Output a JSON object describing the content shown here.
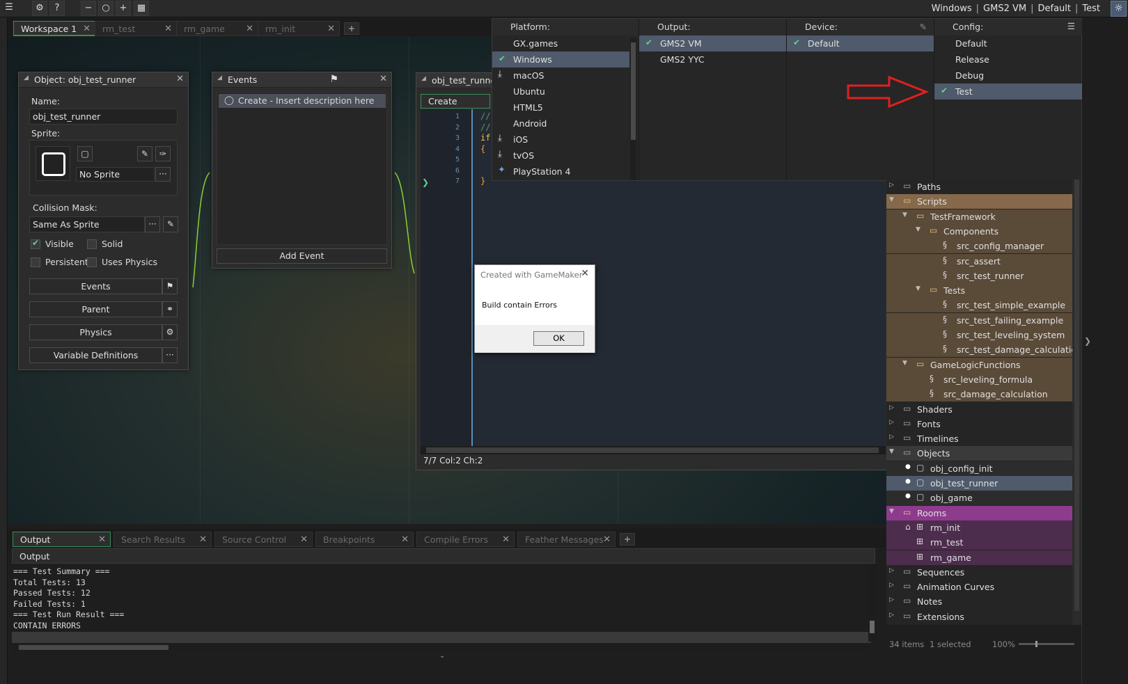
{
  "topbar": {
    "target": {
      "platform": "Windows",
      "output": "GMS2 VM",
      "config": "Default",
      "device": "Test",
      "sep": "|"
    },
    "icons": [
      "gear-icon",
      "help-icon",
      "zoom-out-icon",
      "zoom-reset-icon",
      "zoom-in-icon",
      "fit-icon",
      "target-icon"
    ]
  },
  "workspace_tabs": [
    {
      "label": "Workspace 1",
      "active": true
    },
    {
      "label": "rm_test",
      "active": false
    },
    {
      "label": "rm_game",
      "active": false
    },
    {
      "label": "rm_init",
      "active": false
    }
  ],
  "object_panel": {
    "title": "Object: obj_test_runner",
    "name_label": "Name:",
    "name_value": "obj_test_runner",
    "sprite_label": "Sprite:",
    "sprite_value": "No Sprite",
    "collision_label": "Collision Mask:",
    "collision_value": "Same As Sprite",
    "ellipsis": "···",
    "checkboxes": {
      "visible": {
        "label": "Visible",
        "checked": true
      },
      "solid": {
        "label": "Solid",
        "checked": false
      },
      "persistent": {
        "label": "Persistent",
        "checked": false
      },
      "uses_physics": {
        "label": "Uses Physics",
        "checked": false
      }
    },
    "buttons": {
      "events": "Events",
      "parent": "Parent",
      "physics": "Physics",
      "variable_definitions": "Variable Definitions"
    }
  },
  "events_panel": {
    "title": "Events",
    "item": "Create - Insert description here",
    "add_event": "Add Event"
  },
  "editor": {
    "title": "obj_test_runner:",
    "tab": "Create",
    "lines": [
      {
        "n": "1",
        "code": "//"
      },
      {
        "n": "2",
        "code": "//"
      },
      {
        "n": "3",
        "code": "if"
      },
      {
        "n": "4",
        "code": "{"
      },
      {
        "n": "5",
        "code": ""
      },
      {
        "n": "6",
        "code": ""
      },
      {
        "n": "7",
        "code": "}"
      }
    ],
    "status": "7/7 Col:2 Ch:2"
  },
  "dropdown": {
    "platform": {
      "header": "Platform:",
      "items": [
        {
          "label": "GX.games",
          "selected": false,
          "mark": ""
        },
        {
          "label": "Windows",
          "selected": true,
          "mark": "check"
        },
        {
          "label": "macOS",
          "selected": false,
          "mark": "download"
        },
        {
          "label": "Ubuntu",
          "selected": false,
          "mark": ""
        },
        {
          "label": "HTML5",
          "selected": false,
          "mark": ""
        },
        {
          "label": "Android",
          "selected": false,
          "mark": ""
        },
        {
          "label": "iOS",
          "selected": false,
          "mark": "download"
        },
        {
          "label": "tvOS",
          "selected": false,
          "mark": "download"
        },
        {
          "label": "PlayStation 4",
          "selected": false,
          "mark": "ps"
        }
      ]
    },
    "output": {
      "header": "Output:",
      "items": [
        {
          "label": "GMS2 VM",
          "selected": true
        },
        {
          "label": "GMS2 YYC",
          "selected": false
        }
      ]
    },
    "device": {
      "header": "Device:",
      "items": [
        {
          "label": "Default",
          "selected": true
        }
      ]
    },
    "config": {
      "header": "Config:",
      "items": [
        {
          "label": "Default",
          "selected": false
        },
        {
          "label": "Release",
          "selected": false
        },
        {
          "label": "Debug",
          "selected": false
        },
        {
          "label": "Test",
          "selected": true
        }
      ]
    }
  },
  "dialog": {
    "title": "Created with GameMaker",
    "message": "Build contain Errors",
    "ok": "OK"
  },
  "bottom_tabs": [
    {
      "label": "Output",
      "active": true
    },
    {
      "label": "Search Results",
      "active": false
    },
    {
      "label": "Source Control",
      "active": false
    },
    {
      "label": "Breakpoints",
      "active": false
    },
    {
      "label": "Compile Errors",
      "active": false
    },
    {
      "label": "Feather Messages",
      "active": false
    }
  ],
  "output": {
    "header": "Output",
    "lines": [
      "=== Test Summary ===",
      "Total Tests: 13",
      "Passed Tests: 12",
      "Failed Tests: 1",
      "=== Test Run Result ===",
      "CONTAIN ERRORS"
    ]
  },
  "asset_browser": {
    "rows": [
      {
        "label": "Paths",
        "depth": 0,
        "kind": "folder",
        "arrow": "right",
        "bg": ""
      },
      {
        "label": "Scripts",
        "depth": 0,
        "kind": "folder-open",
        "arrow": "down",
        "bg": "#86694a"
      },
      {
        "label": "TestFramework",
        "depth": 1,
        "kind": "folder-open",
        "arrow": "down",
        "bg": "#5a4a38"
      },
      {
        "label": "Components",
        "depth": 2,
        "kind": "folder-open",
        "arrow": "down",
        "bg": "#5a4a38"
      },
      {
        "label": "src_config_manager",
        "depth": 3,
        "kind": "script",
        "arrow": "",
        "bg": "#5a4a38"
      },
      {
        "label": "src_assert",
        "depth": 3,
        "kind": "script",
        "arrow": "",
        "bg": "#5a4a38"
      },
      {
        "label": "src_test_runner",
        "depth": 3,
        "kind": "script",
        "arrow": "",
        "bg": "#5a4a38"
      },
      {
        "label": "Tests",
        "depth": 2,
        "kind": "folder-open",
        "arrow": "down",
        "bg": "#5a4a38"
      },
      {
        "label": "src_test_simple_example",
        "depth": 3,
        "kind": "script",
        "arrow": "",
        "bg": "#5a4a38"
      },
      {
        "label": "src_test_failing_example",
        "depth": 3,
        "kind": "script",
        "arrow": "",
        "bg": "#5a4a38"
      },
      {
        "label": "src_test_leveling_system",
        "depth": 3,
        "kind": "script",
        "arrow": "",
        "bg": "#5a4a38"
      },
      {
        "label": "src_test_damage_calculation",
        "depth": 3,
        "kind": "script",
        "arrow": "",
        "bg": "#5a4a38"
      },
      {
        "label": "GameLogicFunctions",
        "depth": 1,
        "kind": "folder-open",
        "arrow": "down",
        "bg": "#5a4a38"
      },
      {
        "label": "src_leveling_formula",
        "depth": 2,
        "kind": "script",
        "arrow": "",
        "bg": "#5a4a38"
      },
      {
        "label": "src_damage_calculation",
        "depth": 2,
        "kind": "script",
        "arrow": "",
        "bg": "#5a4a38"
      },
      {
        "label": "Shaders",
        "depth": 0,
        "kind": "folder",
        "arrow": "right",
        "bg": ""
      },
      {
        "label": "Fonts",
        "depth": 0,
        "kind": "folder",
        "arrow": "right",
        "bg": ""
      },
      {
        "label": "Timelines",
        "depth": 0,
        "kind": "folder",
        "arrow": "right",
        "bg": ""
      },
      {
        "label": "Objects",
        "depth": 0,
        "kind": "folder-open",
        "arrow": "down",
        "bg": "#3a3a3a"
      },
      {
        "label": "obj_config_init",
        "depth": 1,
        "kind": "object",
        "arrow": "",
        "bg": "#2c2c2c"
      },
      {
        "label": "obj_test_runner",
        "depth": 1,
        "kind": "object",
        "arrow": "",
        "bg": "#4f5a6b"
      },
      {
        "label": "obj_game",
        "depth": 1,
        "kind": "object",
        "arrow": "",
        "bg": "#2c2c2c"
      },
      {
        "label": "Rooms",
        "depth": 0,
        "kind": "folder-open",
        "arrow": "down",
        "bg": "#8d3c8d"
      },
      {
        "label": "rm_init",
        "depth": 1,
        "kind": "room-home",
        "arrow": "",
        "bg": "#4d2d4d"
      },
      {
        "label": "rm_test",
        "depth": 1,
        "kind": "room",
        "arrow": "",
        "bg": "#4d2d4d"
      },
      {
        "label": "rm_game",
        "depth": 1,
        "kind": "room",
        "arrow": "",
        "bg": "#4d2d4d"
      },
      {
        "label": "Sequences",
        "depth": 0,
        "kind": "folder",
        "arrow": "right",
        "bg": ""
      },
      {
        "label": "Animation Curves",
        "depth": 0,
        "kind": "folder",
        "arrow": "right",
        "bg": ""
      },
      {
        "label": "Notes",
        "depth": 0,
        "kind": "folder",
        "arrow": "right",
        "bg": ""
      },
      {
        "label": "Extensions",
        "depth": 0,
        "kind": "folder",
        "arrow": "right",
        "bg": ""
      }
    ],
    "footer": {
      "items": "34 items",
      "selected": "1 selected",
      "zoom": "100%"
    }
  }
}
